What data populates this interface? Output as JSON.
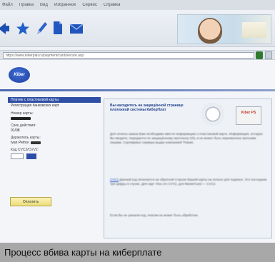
{
  "menubar": {
    "items": [
      "Файл",
      "Правка",
      "Вид",
      "Избранное",
      "Сервис",
      "Справка"
    ]
  },
  "toolbar": {
    "icons": [
      "back-icon",
      "favorites-icon",
      "edit-icon",
      "document-icon",
      "mail-icon"
    ]
  },
  "addressbar": {
    "url": "https://www.kiberplat.ru/payment/card/secure.asp"
  },
  "site": {
    "logo_text": "Kiber"
  },
  "form": {
    "menu_items": [
      "Платеж с пластиковой карты",
      "Регистрация банковских карт"
    ],
    "card_number_label": "Номер карты:",
    "expiry_label": "Срок действия:",
    "expiry_value": "01/08",
    "holder_label": "Держатель карты:",
    "holder_value": "Ivan Petrov",
    "cvc_label": "Код CVC2/CVV2:",
    "pay_button": "Оплатить"
  },
  "panel": {
    "title": "Вы находитесь на защищённой странице платежной системы КиберПлат",
    "badge": "Kiber PS",
    "para1": "Для оплаты заказа Вам необходимо ввести информацию о пластиковой карте. Информация, которую Вы вводите, передается по защищённому протоколу SSL и не может быть перехвачена третьими лицами. Сертификат сервера выдан компанией Thawte.",
    "para2_link": "CVC2",
    "para2": "Данный код печатается на обратной стороне Вашей карты на полосе для подписи. Это последние три цифры в строке. Для карт Visa это CVV2, для MasterCard — CVC2.",
    "para3": "Если Вы не указали код, платеж не может быть обработан."
  },
  "caption": "Процесс вбива карты на киберплате"
}
